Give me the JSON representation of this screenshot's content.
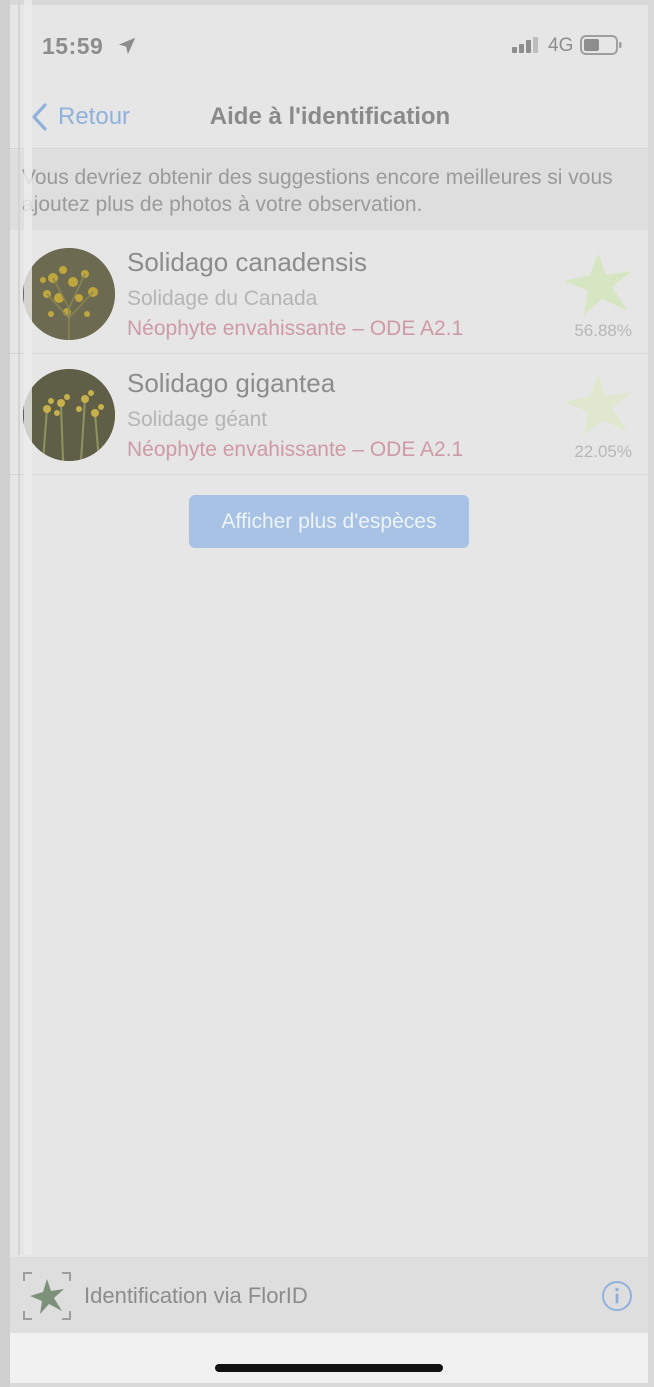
{
  "status_bar": {
    "time": "15:59",
    "network": "4G"
  },
  "nav": {
    "back_label": "Retour",
    "title": "Aide à l'identification"
  },
  "hint": "Vous devriez obtenir des suggestions encore meilleures si vous ajoutez plus de photos à votre observation.",
  "suggestions": [
    {
      "scientific_name": "Solidago canadensis",
      "common_name": "Solidage du Canada",
      "status": "Néophyte envahissante – ODE A2.1",
      "score": "56.88%"
    },
    {
      "scientific_name": "Solidago gigantea",
      "common_name": "Solidage géant",
      "status": "Néophyte envahissante – ODE A2.1",
      "score": "22.05%"
    }
  ],
  "more_button_label": "Afficher plus d'espèces",
  "footer": {
    "label": "Identification via FlorID"
  },
  "colors": {
    "accent": "#8fb2dc",
    "button_bg": "#a7c2e4",
    "invasive_tag": "#cf9aa6",
    "score_star": "#d7e6c2"
  }
}
